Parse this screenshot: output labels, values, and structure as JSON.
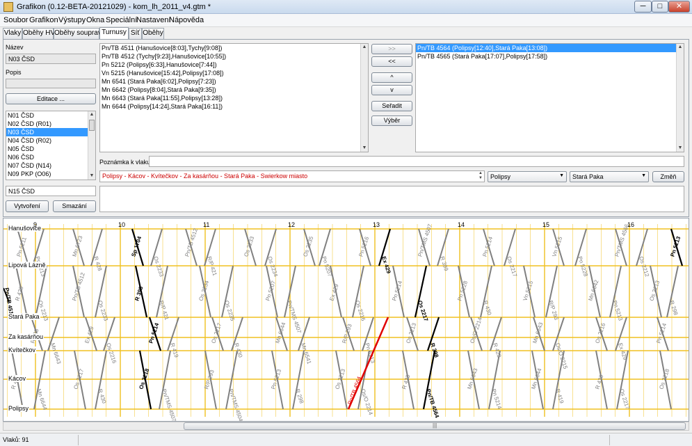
{
  "window": {
    "title": "Grafikon (0.12-BETA-20121029) - kom_lh_2011_v4.gtm *",
    "controls": {
      "minimize": "─",
      "maximize": "□",
      "close": "✕"
    }
  },
  "menu": [
    "Soubor",
    "Grafikon",
    "Výstupy",
    "Okna",
    "Speciální",
    "Nastavení",
    "Nápověda"
  ],
  "tabs": [
    "Vlaky",
    "Oběhy HV",
    "Oběhy souprav",
    "Turnusy",
    "Síť",
    "Oběhy"
  ],
  "active_tab": "Turnusy",
  "left": {
    "name_label": "Název",
    "name_value": "N03 ČSD",
    "desc_label": "Popis",
    "desc_value": "",
    "edit_button": "Editace ...",
    "circulations": [
      "N01 ČSD",
      "N02 ČSD (R01)",
      "N03 ČSD",
      "N04 ČSD (R02)",
      "N05 ČSD",
      "N06 ČSD",
      "N07 ČSD (N14)",
      "N09 PKP (O06)"
    ],
    "selected_index": 2,
    "new_name": "N15 ČSD",
    "create_button": "Vytvoření",
    "delete_button": "Smazání"
  },
  "available_trains": [
    "Pn/TB 4511 (Hanušovice[8:03],Tychy[9:08])",
    "Pn/TB 4512 (Tychy[9:23],Hanušovice[10:55])",
    "Pn 5212 (Polipsy[6:33],Hanušovice[7:44])",
    "Vn 5215 (Hanušovice[15:42],Polipsy[17:08])",
    "Mn 6541 (Stará Paka[6:02],Polipsy[7:23])",
    "Mn 6642 (Polipsy[8:04],Stará Paka[9:35])",
    "Mn 6643 (Stará Paka[11:55],Polipsy[13:28])",
    "Mn 6644 (Polipsy[14:24],Stará Paka[16:11])"
  ],
  "middle_buttons": [
    ">>",
    "<<",
    "^",
    "v",
    "Seřadit",
    "Výběr"
  ],
  "assigned_trains": [
    "Pn/TB 4564 (Polipsy[12:40],Stará Paka[13:08])",
    "Pn/TB 4565 (Stará Paka[17:07],Polipsy[17:58])"
  ],
  "assigned_selected_index": 0,
  "note_label": "Poznámka k vlaku:",
  "note_value": "",
  "route_text": "Polipsy - Kácov - Kvítečkov - Za kasárňou - Stará Paka - Swierkow miasto",
  "from_station": "Polipsy",
  "to_station": "Stará Paka",
  "change_button": "Změň",
  "status": "Vlaků: 91",
  "colors": {
    "grid": "#f0c020",
    "highlight": "#e00000",
    "train": "#808080",
    "selected": "#000000",
    "route_text": "#cc0000"
  },
  "graph": {
    "stations": [
      "Hanušovice",
      "Lipová Lázně",
      "Stará Paka",
      "Za kasárňou",
      "Kvítečkov",
      "Kácov",
      "Polipsy"
    ],
    "hours": [
      9,
      10,
      11,
      12,
      13,
      14,
      15,
      16
    ],
    "train_labels": [
      "Pn 5211",
      "Pn 5213",
      "Mn 6723",
      "R 428",
      "Sp 1704",
      "Os 2233",
      "Pn/TB 4512",
      "R/P 421",
      "Os 2233",
      "Os 2234",
      "Os 2235",
      "Pn 5207",
      "Pn 5216",
      "Ex 429",
      "Pn/TMS 4507",
      "R 399",
      "Pn 5214",
      "Os 2217",
      "Vn 5215",
      "Pn 5228",
      "Pn/TMS 4566",
      "Os 2212",
      "Pn 5213",
      "R 428",
      "Os 2213",
      "Pn/TB 4512",
      "Os 2233",
      "R 398",
      "R/P 421",
      "Os 2234",
      "Os 2235",
      "Pn 5207",
      "Pn/TMS 4507",
      "Ex 429",
      "Os 2216",
      "Pn 5214",
      "Os 2217",
      "Pn 5228",
      "R 430",
      "Vn 5215",
      "R/P 293",
      "Mn 6642",
      "Pn 5213",
      "Os 2213",
      "R 298",
      "R 423",
      "Mn 6643",
      "Ex 429",
      "Os 2216",
      "Pn 5214",
      "R 419",
      "Os 2217",
      "R 430",
      "Mn 6644",
      "Mn 6541",
      "R/P 293",
      "Pn 5213",
      "Os 2213",
      "R 398",
      "Os/O 2214",
      "R 423",
      "Mn 6643",
      "Os/O 2215",
      "Os 2216",
      "Ex 429",
      "Pn 5214",
      "R 419",
      "Mn 6644",
      "Os 2217",
      "R 430",
      "Os 2218",
      "Pn/TMS 4507",
      "R/P 293",
      "Pn/TMS 4504",
      "Pn 5213",
      "R 298",
      "Os 2213",
      "Os/O 2214",
      "R 423",
      "Pn/TB 4564",
      "Mn 6643",
      "Pn 5214",
      "Mn 6644",
      "R 419",
      "R 430",
      "Os 2217",
      "Os 2218",
      "Pn/TB 4564",
      "Pn/TB 4511"
    ]
  }
}
